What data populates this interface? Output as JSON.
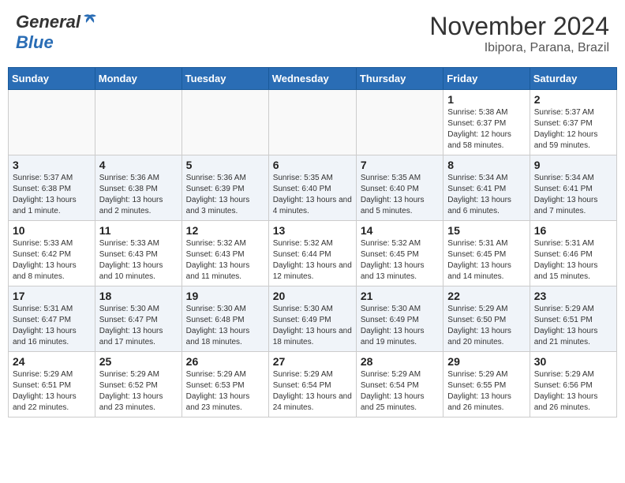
{
  "header": {
    "logo_general": "General",
    "logo_blue": "Blue",
    "month_title": "November 2024",
    "location": "Ibipora, Parana, Brazil"
  },
  "days_of_week": [
    "Sunday",
    "Monday",
    "Tuesday",
    "Wednesday",
    "Thursday",
    "Friday",
    "Saturday"
  ],
  "weeks": [
    [
      {
        "day": "",
        "info": ""
      },
      {
        "day": "",
        "info": ""
      },
      {
        "day": "",
        "info": ""
      },
      {
        "day": "",
        "info": ""
      },
      {
        "day": "",
        "info": ""
      },
      {
        "day": "1",
        "info": "Sunrise: 5:38 AM\nSunset: 6:37 PM\nDaylight: 12 hours and 58 minutes."
      },
      {
        "day": "2",
        "info": "Sunrise: 5:37 AM\nSunset: 6:37 PM\nDaylight: 12 hours and 59 minutes."
      }
    ],
    [
      {
        "day": "3",
        "info": "Sunrise: 5:37 AM\nSunset: 6:38 PM\nDaylight: 13 hours and 1 minute."
      },
      {
        "day": "4",
        "info": "Sunrise: 5:36 AM\nSunset: 6:38 PM\nDaylight: 13 hours and 2 minutes."
      },
      {
        "day": "5",
        "info": "Sunrise: 5:36 AM\nSunset: 6:39 PM\nDaylight: 13 hours and 3 minutes."
      },
      {
        "day": "6",
        "info": "Sunrise: 5:35 AM\nSunset: 6:40 PM\nDaylight: 13 hours and 4 minutes."
      },
      {
        "day": "7",
        "info": "Sunrise: 5:35 AM\nSunset: 6:40 PM\nDaylight: 13 hours and 5 minutes."
      },
      {
        "day": "8",
        "info": "Sunrise: 5:34 AM\nSunset: 6:41 PM\nDaylight: 13 hours and 6 minutes."
      },
      {
        "day": "9",
        "info": "Sunrise: 5:34 AM\nSunset: 6:41 PM\nDaylight: 13 hours and 7 minutes."
      }
    ],
    [
      {
        "day": "10",
        "info": "Sunrise: 5:33 AM\nSunset: 6:42 PM\nDaylight: 13 hours and 8 minutes."
      },
      {
        "day": "11",
        "info": "Sunrise: 5:33 AM\nSunset: 6:43 PM\nDaylight: 13 hours and 10 minutes."
      },
      {
        "day": "12",
        "info": "Sunrise: 5:32 AM\nSunset: 6:43 PM\nDaylight: 13 hours and 11 minutes."
      },
      {
        "day": "13",
        "info": "Sunrise: 5:32 AM\nSunset: 6:44 PM\nDaylight: 13 hours and 12 minutes."
      },
      {
        "day": "14",
        "info": "Sunrise: 5:32 AM\nSunset: 6:45 PM\nDaylight: 13 hours and 13 minutes."
      },
      {
        "day": "15",
        "info": "Sunrise: 5:31 AM\nSunset: 6:45 PM\nDaylight: 13 hours and 14 minutes."
      },
      {
        "day": "16",
        "info": "Sunrise: 5:31 AM\nSunset: 6:46 PM\nDaylight: 13 hours and 15 minutes."
      }
    ],
    [
      {
        "day": "17",
        "info": "Sunrise: 5:31 AM\nSunset: 6:47 PM\nDaylight: 13 hours and 16 minutes."
      },
      {
        "day": "18",
        "info": "Sunrise: 5:30 AM\nSunset: 6:47 PM\nDaylight: 13 hours and 17 minutes."
      },
      {
        "day": "19",
        "info": "Sunrise: 5:30 AM\nSunset: 6:48 PM\nDaylight: 13 hours and 18 minutes."
      },
      {
        "day": "20",
        "info": "Sunrise: 5:30 AM\nSunset: 6:49 PM\nDaylight: 13 hours and 18 minutes."
      },
      {
        "day": "21",
        "info": "Sunrise: 5:30 AM\nSunset: 6:49 PM\nDaylight: 13 hours and 19 minutes."
      },
      {
        "day": "22",
        "info": "Sunrise: 5:29 AM\nSunset: 6:50 PM\nDaylight: 13 hours and 20 minutes."
      },
      {
        "day": "23",
        "info": "Sunrise: 5:29 AM\nSunset: 6:51 PM\nDaylight: 13 hours and 21 minutes."
      }
    ],
    [
      {
        "day": "24",
        "info": "Sunrise: 5:29 AM\nSunset: 6:51 PM\nDaylight: 13 hours and 22 minutes."
      },
      {
        "day": "25",
        "info": "Sunrise: 5:29 AM\nSunset: 6:52 PM\nDaylight: 13 hours and 23 minutes."
      },
      {
        "day": "26",
        "info": "Sunrise: 5:29 AM\nSunset: 6:53 PM\nDaylight: 13 hours and 23 minutes."
      },
      {
        "day": "27",
        "info": "Sunrise: 5:29 AM\nSunset: 6:54 PM\nDaylight: 13 hours and 24 minutes."
      },
      {
        "day": "28",
        "info": "Sunrise: 5:29 AM\nSunset: 6:54 PM\nDaylight: 13 hours and 25 minutes."
      },
      {
        "day": "29",
        "info": "Sunrise: 5:29 AM\nSunset: 6:55 PM\nDaylight: 13 hours and 26 minutes."
      },
      {
        "day": "30",
        "info": "Sunrise: 5:29 AM\nSunset: 6:56 PM\nDaylight: 13 hours and 26 minutes."
      }
    ]
  ]
}
